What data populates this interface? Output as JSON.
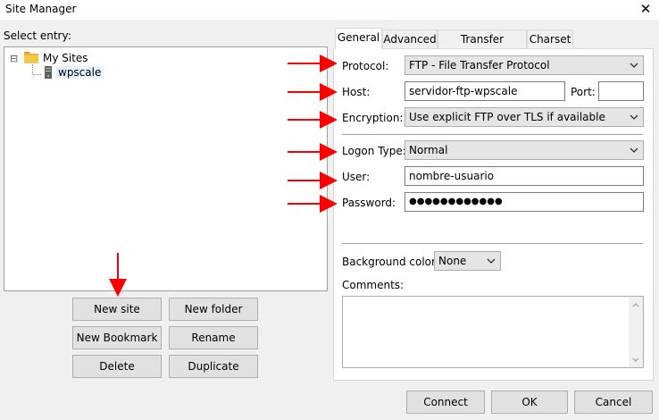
{
  "window": {
    "title": "Site Manager"
  },
  "left": {
    "select_entry_label": "Select entry:",
    "tree": {
      "root_label": "My Sites",
      "root_toggle": "⊟",
      "site_label": "wpscale"
    },
    "buttons": {
      "new_site": "New site",
      "new_folder": "New folder",
      "new_bookmark": "New Bookmark",
      "rename": "Rename",
      "delete": "Delete",
      "duplicate": "Duplicate"
    }
  },
  "tabs": [
    "General",
    "Advanced",
    "Transfer Settings",
    "Charset"
  ],
  "general": {
    "protocol_label": "Protocol:",
    "protocol_value": "FTP - File Transfer Protocol",
    "host_label": "Host:",
    "host_value": "servidor-ftp-wpscale",
    "port_label": "Port:",
    "port_value": "",
    "encryption_label": "Encryption:",
    "encryption_value": "Use explicit FTP over TLS if available",
    "logon_type_label": "Logon Type:",
    "logon_type_value": "Normal",
    "user_label": "User:",
    "user_value": "nombre-usuario",
    "password_label": "Password:",
    "password_value": "●●●●●●●●●●●●",
    "background_color_label": "Background color:",
    "background_color_value": "None",
    "comments_label": "Comments:",
    "comments_value": ""
  },
  "footer": {
    "connect": "Connect",
    "ok": "OK",
    "cancel": "Cancel"
  },
  "colors": {
    "annotation_arrow": "#ff0000",
    "folder": "#e8b830",
    "window_bg": "#f0f0f0"
  }
}
